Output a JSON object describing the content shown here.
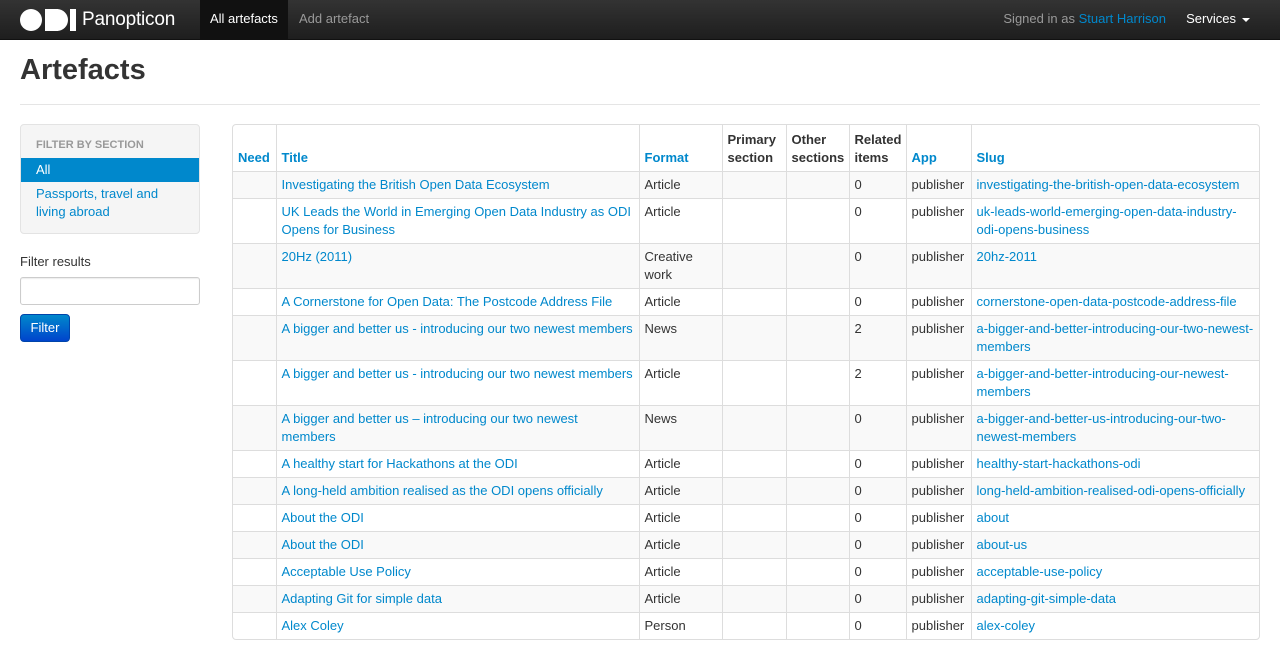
{
  "navbar": {
    "brand": "Panopticon",
    "logo_text": "ODI",
    "nav": [
      "All artefacts",
      "Add artefact"
    ],
    "signed_in_prefix": "Signed in as",
    "user": "Stuart Harrison",
    "services": "Services"
  },
  "page": {
    "title": "Artefacts"
  },
  "sidebar": {
    "header": "Filter by section",
    "items": [
      "All",
      "Passports, travel and living abroad"
    ],
    "filter_label": "Filter results",
    "filter_value": "",
    "filter_button": "Filter"
  },
  "table": {
    "columns": [
      "Need",
      "Title",
      "Format",
      "Primary section",
      "Other sections",
      "Related items",
      "App",
      "Slug"
    ],
    "rows": [
      {
        "need": "",
        "title": "Investigating the British Open Data Ecosystem",
        "format": "Article",
        "primary": "",
        "other": "",
        "related": "0",
        "app": "publisher",
        "slug": "investigating-the-british-open-data-ecosystem"
      },
      {
        "need": "",
        "title": "UK Leads the World in Emerging Open Data Industry as ODI Opens for Business",
        "format": "Article",
        "primary": "",
        "other": "",
        "related": "0",
        "app": "publisher",
        "slug": "uk-leads-world-emerging-open-data-industry-odi-opens-business"
      },
      {
        "need": "",
        "title": "20Hz (2011)",
        "format": "Creative work",
        "primary": "",
        "other": "",
        "related": "0",
        "app": "publisher",
        "slug": "20hz-2011"
      },
      {
        "need": "",
        "title": "A Cornerstone for Open Data: The Postcode Address File",
        "format": "Article",
        "primary": "",
        "other": "",
        "related": "0",
        "app": "publisher",
        "slug": "cornerstone-open-data-postcode-address-file"
      },
      {
        "need": "",
        "title": "A bigger and better us - introducing our two newest members",
        "format": "News",
        "primary": "",
        "other": "",
        "related": "2",
        "app": "publisher",
        "slug": "a-bigger-and-better-introducing-our-two-newest-members"
      },
      {
        "need": "",
        "title": "A bigger and better us - introducing our two newest members",
        "format": "Article",
        "primary": "",
        "other": "",
        "related": "2",
        "app": "publisher",
        "slug": "a-bigger-and-better-introducing-our-newest-members"
      },
      {
        "need": "",
        "title": "A bigger and better us – introducing our two newest members",
        "format": "News",
        "primary": "",
        "other": "",
        "related": "0",
        "app": "publisher",
        "slug": "a-bigger-and-better-us-introducing-our-two-newest-members"
      },
      {
        "need": "",
        "title": "A healthy start for Hackathons at the ODI",
        "format": "Article",
        "primary": "",
        "other": "",
        "related": "0",
        "app": "publisher",
        "slug": "healthy-start-hackathons-odi"
      },
      {
        "need": "",
        "title": "A long-held ambition realised as the ODI opens officially",
        "format": "Article",
        "primary": "",
        "other": "",
        "related": "0",
        "app": "publisher",
        "slug": "long-held-ambition-realised-odi-opens-officially"
      },
      {
        "need": "",
        "title": "About the ODI",
        "format": "Article",
        "primary": "",
        "other": "",
        "related": "0",
        "app": "publisher",
        "slug": "about"
      },
      {
        "need": "",
        "title": "About the ODI",
        "format": "Article",
        "primary": "",
        "other": "",
        "related": "0",
        "app": "publisher",
        "slug": "about-us"
      },
      {
        "need": "",
        "title": "Acceptable Use Policy",
        "format": "Article",
        "primary": "",
        "other": "",
        "related": "0",
        "app": "publisher",
        "slug": "acceptable-use-policy"
      },
      {
        "need": "",
        "title": "Adapting Git for simple data",
        "format": "Article",
        "primary": "",
        "other": "",
        "related": "0",
        "app": "publisher",
        "slug": "adapting-git-simple-data"
      },
      {
        "need": "",
        "title": "Alex Coley",
        "format": "Person",
        "primary": "",
        "other": "",
        "related": "0",
        "app": "publisher",
        "slug": "alex-coley"
      }
    ]
  }
}
